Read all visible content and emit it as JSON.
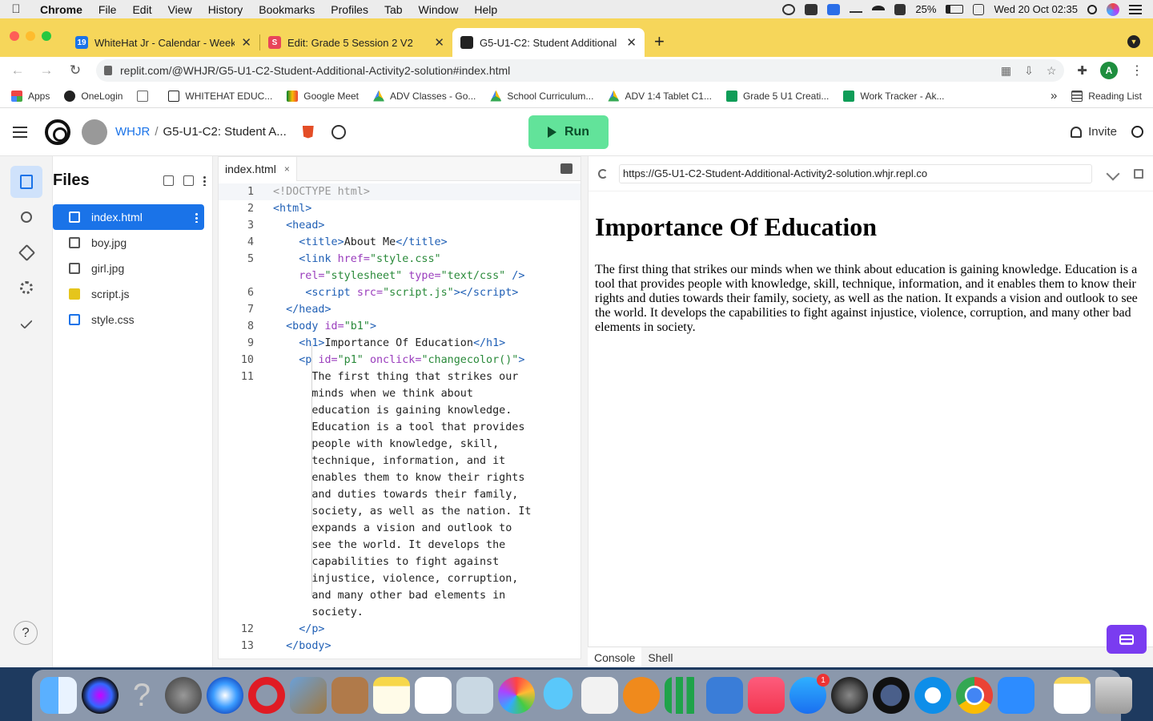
{
  "menubar": {
    "app": "Chrome",
    "items": [
      "File",
      "Edit",
      "View",
      "History",
      "Bookmarks",
      "Profiles",
      "Tab",
      "Window",
      "Help"
    ],
    "battery": "25%",
    "clock": "Wed 20 Oct  02:35"
  },
  "tabs": [
    {
      "title": "WhiteHat Jr - Calendar - Week",
      "favicon_color": "#1a73e8",
      "favicon_text": "19"
    },
    {
      "title": "Edit: Grade 5 Session 2 V2",
      "favicon_color": "#e8445a",
      "favicon_text": "S"
    },
    {
      "title": "G5-U1-C2: Student Additional",
      "favicon_color": "#222222",
      "favicon_text": ""
    }
  ],
  "toolbar": {
    "url": "replit.com/@WHJR/G5-U1-C2-Student-Additional-Activity2-solution#index.html",
    "profile_initial": "A"
  },
  "bookmarks": {
    "items": [
      "Apps",
      "OneLogin",
      "",
      "WHITEHAT EDUC...",
      "Google Meet",
      "ADV Classes - Go...",
      "School Curriculum...",
      "ADV 1:4 Tablet C1...",
      "Grade 5 U1 Creati...",
      "Work Tracker - Ak..."
    ],
    "more": "»",
    "reading_list": "Reading List"
  },
  "replit": {
    "owner": "WHJR",
    "separator": "/",
    "repl_name": "G5-U1-C2: Student A...",
    "run_label": "Run",
    "invite_label": "Invite"
  },
  "files": {
    "title": "Files",
    "items": [
      {
        "name": "index.html",
        "type": "html"
      },
      {
        "name": "boy.jpg",
        "type": "img"
      },
      {
        "name": "girl.jpg",
        "type": "img"
      },
      {
        "name": "script.js",
        "type": "js"
      },
      {
        "name": "style.css",
        "type": "css"
      }
    ],
    "help": "?"
  },
  "editor": {
    "tab": "index.html",
    "tab_close": "×"
  },
  "preview": {
    "url": "https://G5-U1-C2-Student-Additional-Activity2-solution.whjr.repl.co",
    "heading": "Importance Of Education",
    "paragraph": "The first thing that strikes our minds when we think about education is gaining knowledge. Education is a tool that provides people with knowledge, skill, technique, information, and it enables them to know their rights and duties towards their family, society, as well as the nation. It expands a vision and outlook to see the world. It develops the capabilities to fight against injustice, violence, corruption, and many other bad elements in society."
  },
  "console": {
    "tabs": [
      "Console",
      "Shell"
    ]
  },
  "dock": {
    "app_store_badge": "1"
  }
}
